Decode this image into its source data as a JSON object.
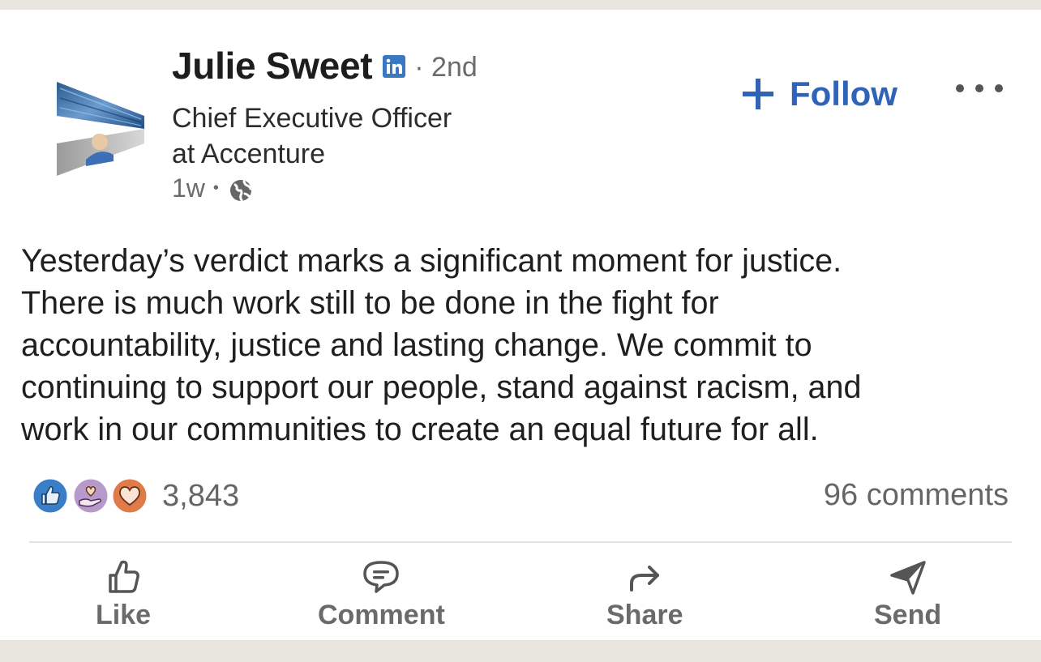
{
  "post": {
    "author": {
      "name": "Julie Sweet",
      "degree": "· 2nd",
      "headline_line1": "Chief Executive Officer",
      "headline_line2": "at Accenture",
      "time": "1w",
      "separator": "•",
      "badge_icon": "linkedin-in-icon",
      "visibility_icon": "globe-icon"
    },
    "follow_label": "Follow",
    "more_icon": "more-horizontal-icon",
    "text_lines": [
      "Yesterday’s verdict marks a significant moment for justice.",
      "There is much work still to be done in the fight for",
      "accountability, justice and lasting change. We commit to",
      "continuing to support our people, stand against racism, and",
      "work in our communities to create an equal future for all."
    ],
    "reactions": {
      "count": "3,843",
      "icons": [
        "like-reaction-icon",
        "support-reaction-icon",
        "love-reaction-icon"
      ]
    },
    "comments": "96 comments"
  },
  "actions": {
    "like": "Like",
    "comment": "Comment",
    "share": "Share",
    "send": "Send"
  },
  "colors": {
    "accent": "#2f63b8",
    "background": "#e9e6df",
    "card": "#ffffff",
    "text": "#1f1f1f",
    "muted": "#6b6b6b"
  }
}
